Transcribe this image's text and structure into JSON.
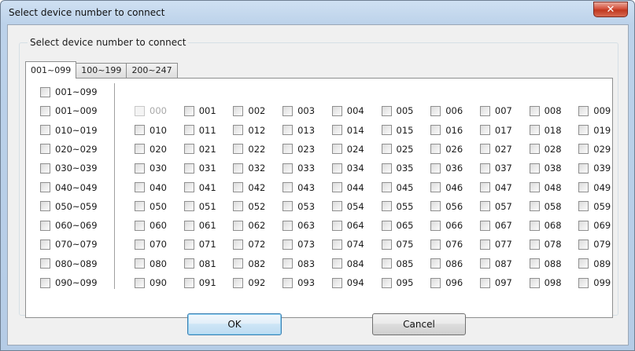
{
  "window": {
    "title": "Select device number to connect",
    "close_glyph": "✕"
  },
  "group": {
    "legend": "Select device number to connect"
  },
  "tabs": [
    {
      "label": "001~099",
      "active": true
    },
    {
      "label": "100~199",
      "active": false
    },
    {
      "label": "200~247",
      "active": false
    }
  ],
  "range_checkboxes": [
    {
      "label": "001~099",
      "checked": false
    },
    {
      "label": "001~009",
      "checked": false
    },
    {
      "label": "010~019",
      "checked": false
    },
    {
      "label": "020~029",
      "checked": false
    },
    {
      "label": "030~039",
      "checked": false
    },
    {
      "label": "040~049",
      "checked": false
    },
    {
      "label": "050~059",
      "checked": false
    },
    {
      "label": "060~069",
      "checked": false
    },
    {
      "label": "070~079",
      "checked": false
    },
    {
      "label": "080~089",
      "checked": false
    },
    {
      "label": "090~099",
      "checked": false
    }
  ],
  "device_grid": {
    "disabled": [
      "000"
    ],
    "rows": [
      [
        "000",
        "001",
        "002",
        "003",
        "004",
        "005",
        "006",
        "007",
        "008",
        "009"
      ],
      [
        "010",
        "011",
        "012",
        "013",
        "014",
        "015",
        "016",
        "017",
        "018",
        "019"
      ],
      [
        "020",
        "021",
        "022",
        "023",
        "024",
        "025",
        "026",
        "027",
        "028",
        "029"
      ],
      [
        "030",
        "031",
        "032",
        "033",
        "034",
        "035",
        "036",
        "037",
        "038",
        "039"
      ],
      [
        "040",
        "041",
        "042",
        "043",
        "044",
        "045",
        "046",
        "047",
        "048",
        "049"
      ],
      [
        "050",
        "051",
        "052",
        "053",
        "054",
        "055",
        "056",
        "057",
        "058",
        "059"
      ],
      [
        "060",
        "061",
        "062",
        "063",
        "064",
        "065",
        "066",
        "067",
        "068",
        "069"
      ],
      [
        "070",
        "071",
        "072",
        "073",
        "074",
        "075",
        "076",
        "077",
        "078",
        "079"
      ],
      [
        "080",
        "081",
        "082",
        "083",
        "084",
        "085",
        "086",
        "087",
        "088",
        "089"
      ],
      [
        "090",
        "091",
        "092",
        "093",
        "094",
        "095",
        "096",
        "097",
        "098",
        "099"
      ]
    ]
  },
  "buttons": {
    "ok_label": "OK",
    "cancel_label": "Cancel"
  }
}
